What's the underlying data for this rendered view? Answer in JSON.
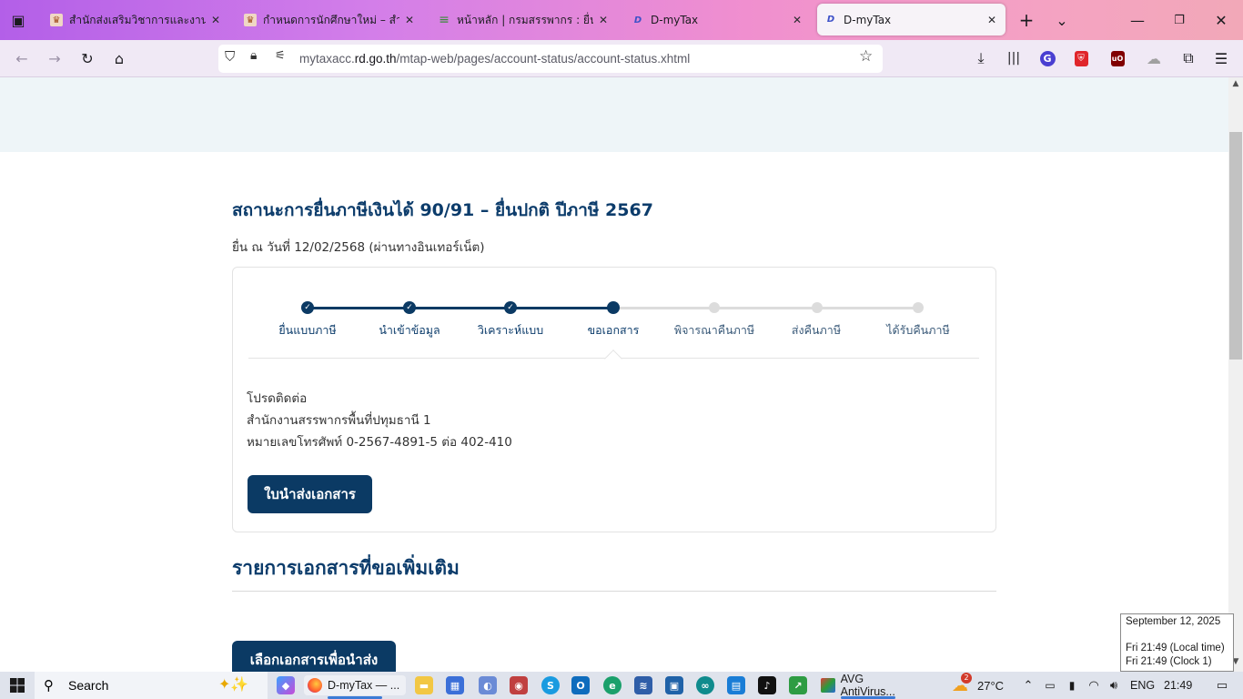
{
  "browser": {
    "tabs": [
      {
        "title": "สำนักส่งเสริมวิชาการและงานทะ",
        "icon": "university-seal-icon",
        "active": false
      },
      {
        "title": "กำหนดการนักศึกษาใหม่ – สำนัก",
        "icon": "university-seal-icon",
        "active": false
      },
      {
        "title": "หน้าหลัก | กรมสรรพากร : ยื่นแบ",
        "icon": "revenue-department-icon",
        "active": false
      },
      {
        "title": "D-myTax",
        "icon": "dmytax-icon",
        "active": false
      },
      {
        "title": "D-myTax",
        "icon": "dmytax-icon",
        "active": true
      }
    ],
    "url_prefix": "mytaxacc.",
    "url_domain": "rd.go.th",
    "url_path": "/mtap-web/pages/account-status/account-status.xhtml"
  },
  "page": {
    "title": "สถานะการยื่นภาษีเงินได้ 90/91 – ยื่นปกติ ปีภาษี 2567",
    "submit_info": "ยื่น ณ วันที่ 12/02/2568 (ผ่านทางอินเทอร์เน็ต)",
    "steps": [
      {
        "label": "ยื่นแบบภาษี",
        "state": "done"
      },
      {
        "label": "นำเข้าข้อมูล",
        "state": "done"
      },
      {
        "label": "วิเคราะห์แบบ",
        "state": "done"
      },
      {
        "label": "ขอเอกสาร",
        "state": "current"
      },
      {
        "label": "พิจารณาคืนภาษี",
        "state": "todo"
      },
      {
        "label": "ส่งคืนภาษี",
        "state": "todo"
      },
      {
        "label": "ได้รับคืนภาษี",
        "state": "todo"
      }
    ],
    "contact_heading": "โปรดติดต่อ",
    "contact_office": "สำนักงานสรรพากรพื้นที่ปทุมธานี 1",
    "contact_phone": "หมายเลขโทรศัพท์ 0-2567-4891-5 ต่อ 402-410",
    "submit_doc_button": "ใบนำส่งเอกสาร",
    "docs_heading": "รายการเอกสารที่ขอเพิ่มเติม",
    "select_docs_button": "เลือกเอกสารเพื่อนำส่ง"
  },
  "clock_popup": {
    "date": "September 12, 2025",
    "local": "Fri 21:49  (Local time)",
    "clock1": "Fri 21:49  (Clock 1)"
  },
  "taskbar": {
    "search_label": "Search",
    "firefox_task": "D-myTax — ...",
    "avg_task": "AVG AntiVirus...",
    "weather_temp": "27°C",
    "weather_badge": "2",
    "language": "ENG",
    "time": "21:49"
  },
  "colors": {
    "primary": "#0b3a64",
    "step_todo": "#dcdcdc",
    "header_band": "#eef5f8"
  }
}
